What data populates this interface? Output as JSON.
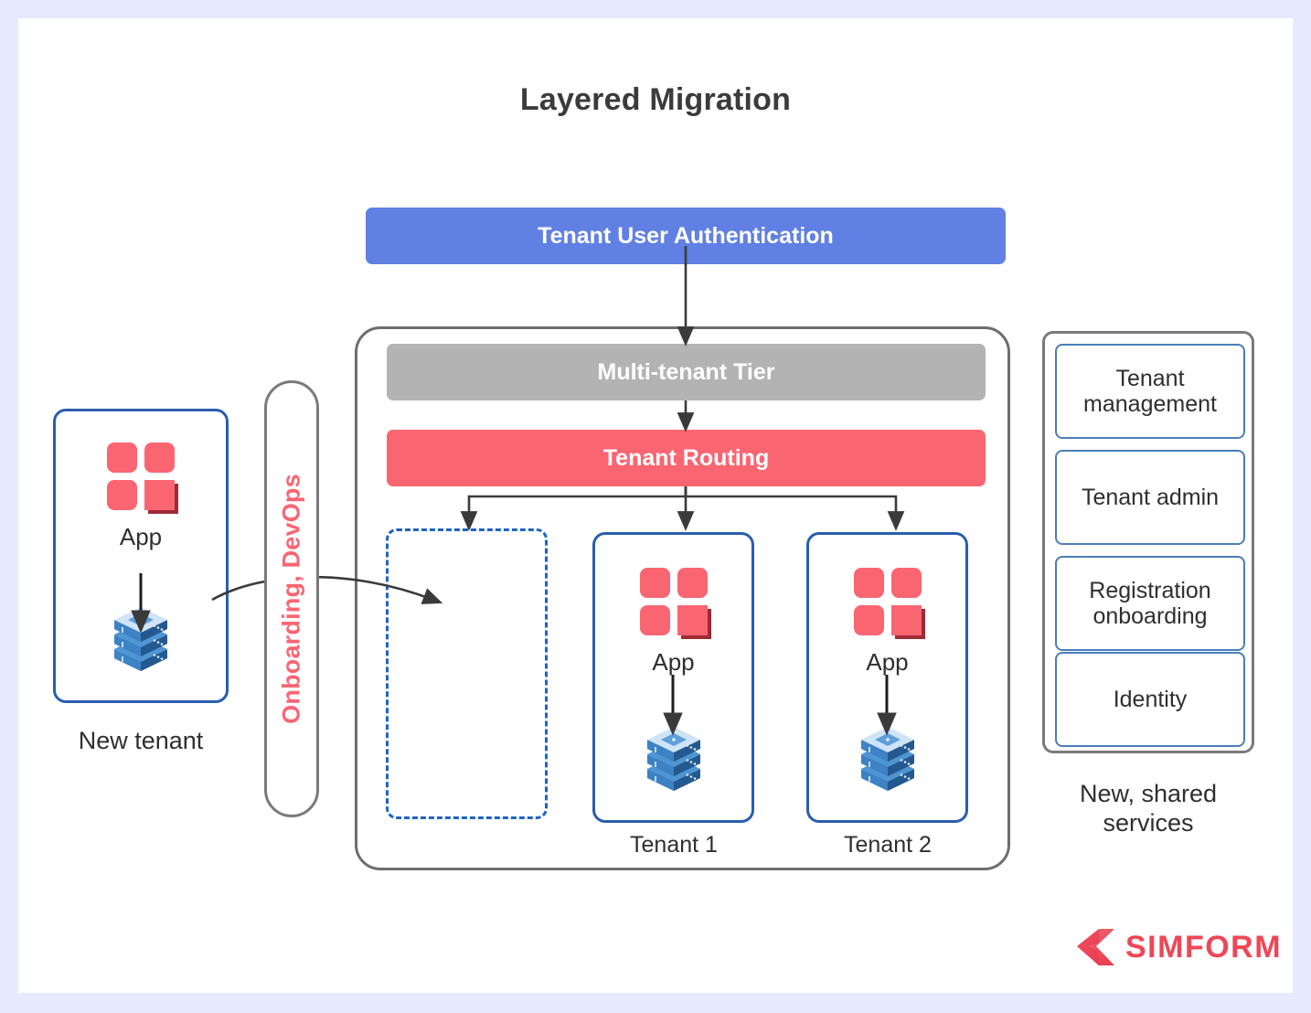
{
  "title": "Layered Migration",
  "colors": {
    "page_bg": "#E6EAFC",
    "canvas": "#FFFFFF",
    "accent_blue": "#6180E3",
    "accent_red": "#FA6572",
    "tier_gray": "#B3B3B3",
    "border_blue": "#2A5EAC",
    "border_gray": "#6E6E6E",
    "service_blue": "#4A7EBB",
    "logo_red": "#EE4757"
  },
  "auth_bar": {
    "label": "Tenant User Authentication"
  },
  "multi_tenant": {
    "tier_label": "Multi-tenant Tier",
    "routing_label": "Tenant Routing",
    "tenants": [
      {
        "id": "empty",
        "label": "",
        "app_label": "",
        "empty": true
      },
      {
        "id": "tenant-1",
        "label": "Tenant 1",
        "app_label": "App",
        "empty": false
      },
      {
        "id": "tenant-2",
        "label": "Tenant 2",
        "app_label": "App",
        "empty": false
      }
    ]
  },
  "onboarding": {
    "label": "Onboarding, DevOps"
  },
  "new_tenant": {
    "card_app_label": "App",
    "caption": "New tenant"
  },
  "shared_services": {
    "items": [
      {
        "label": "Tenant management"
      },
      {
        "label": "Tenant admin"
      },
      {
        "label": "Registration onboarding"
      },
      {
        "label": "Identity"
      }
    ],
    "caption": "New, shared services"
  },
  "logo": {
    "wordmark": "SIMFORM",
    "mark": "simform-chevron-icon"
  }
}
